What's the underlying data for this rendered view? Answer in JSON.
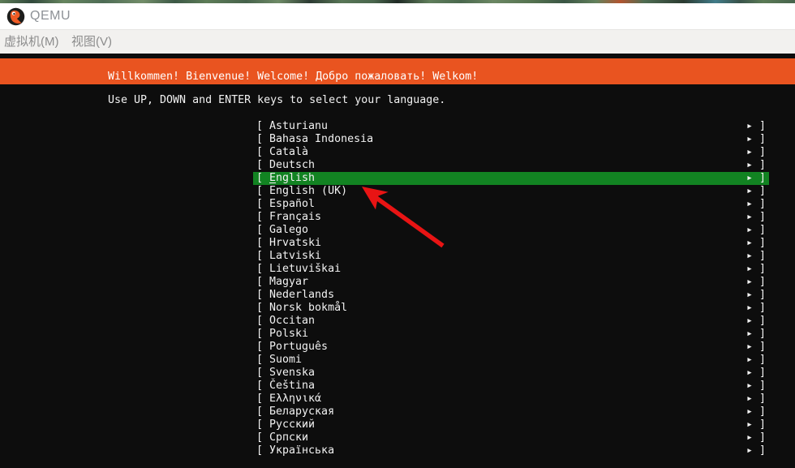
{
  "window": {
    "title": "QEMU",
    "logo_icon": "qemu-bird-logo",
    "menu": [
      {
        "label": "虚拟机(M)"
      },
      {
        "label": "视图(V)"
      }
    ]
  },
  "console": {
    "background": "#0d0d0d",
    "text_color": "#f2f2f2",
    "banner": {
      "text": "Willkommen! Bienvenue! Welcome! Добро пожаловать! Welkom!",
      "background": "#e95420"
    },
    "instruction": "Use UP, DOWN and ENTER keys to select your language.",
    "language_list": {
      "open_bracket": "[",
      "close_bracket": "]",
      "expand_glyph": "▸",
      "selected_background": "#128322",
      "selected_index": 4,
      "items": [
        {
          "label": "Asturianu",
          "selected": false
        },
        {
          "label": "Bahasa Indonesia",
          "selected": false
        },
        {
          "label": "Català",
          "selected": false
        },
        {
          "label": "Deutsch",
          "selected": false
        },
        {
          "label": "English",
          "selected": true
        },
        {
          "label": "English (UK)",
          "selected": false
        },
        {
          "label": "Español",
          "selected": false
        },
        {
          "label": "Français",
          "selected": false
        },
        {
          "label": "Galego",
          "selected": false
        },
        {
          "label": "Hrvatski",
          "selected": false
        },
        {
          "label": "Latviski",
          "selected": false
        },
        {
          "label": "Lietuviškai",
          "selected": false
        },
        {
          "label": "Magyar",
          "selected": false
        },
        {
          "label": "Nederlands",
          "selected": false
        },
        {
          "label": "Norsk bokmål",
          "selected": false
        },
        {
          "label": "Occitan",
          "selected": false
        },
        {
          "label": "Polski",
          "selected": false
        },
        {
          "label": "Português",
          "selected": false
        },
        {
          "label": "Suomi",
          "selected": false
        },
        {
          "label": "Svenska",
          "selected": false
        },
        {
          "label": "Čeština",
          "selected": false
        },
        {
          "label": "Ελληνικά",
          "selected": false
        },
        {
          "label": "Беларуская",
          "selected": false
        },
        {
          "label": "Русский",
          "selected": false
        },
        {
          "label": "Српски",
          "selected": false
        },
        {
          "label": "Українська",
          "selected": false
        }
      ]
    }
  },
  "annotation": {
    "shape": "arrow",
    "color": "#e81414",
    "points_at": "English"
  }
}
